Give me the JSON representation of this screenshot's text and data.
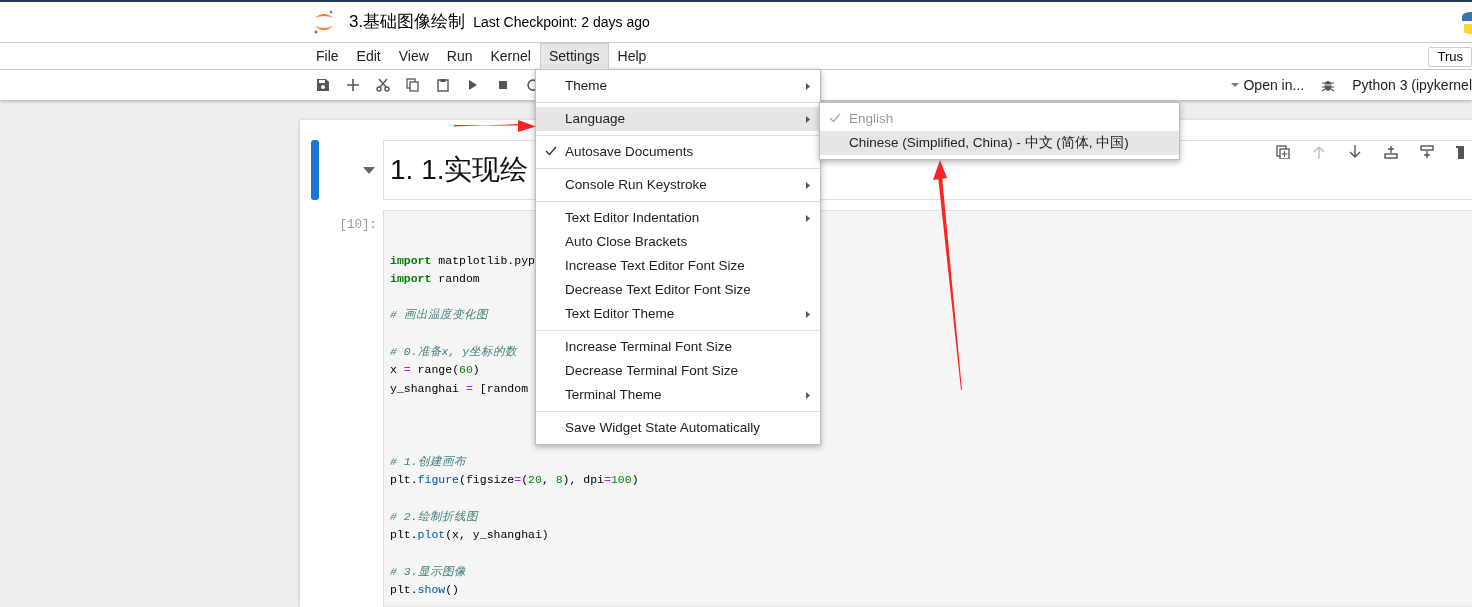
{
  "header": {
    "title": "3.基础图像绘制",
    "checkpoint": "Last Checkpoint: 2 days ago"
  },
  "menubar": [
    {
      "label": "File",
      "selected": false
    },
    {
      "label": "Edit",
      "selected": false
    },
    {
      "label": "View",
      "selected": false
    },
    {
      "label": "Run",
      "selected": false
    },
    {
      "label": "Kernel",
      "selected": false
    },
    {
      "label": "Settings",
      "selected": true
    },
    {
      "label": "Help",
      "selected": false
    }
  ],
  "trust_button": "Trus",
  "toolbar": {
    "open_in": "Open in...",
    "kernel": "Python 3 (ipykernel"
  },
  "cells": [
    {
      "kind": "markdown",
      "active": true,
      "heading": "1. 1.实现绘"
    },
    {
      "kind": "code",
      "active": false,
      "prompt": "[10]:",
      "lines": [
        {
          "kind": "blank"
        },
        {
          "kind": "blank"
        },
        {
          "kind": "code",
          "tokens": [
            {
              "kind": "kw",
              "text": "import"
            },
            {
              "kind": "plain",
              "text": " matplotlib.pyp"
            }
          ]
        },
        {
          "kind": "code",
          "tokens": [
            {
              "kind": "kw",
              "text": "import"
            },
            {
              "kind": "plain",
              "text": " random"
            }
          ]
        },
        {
          "kind": "blank"
        },
        {
          "kind": "code",
          "tokens": [
            {
              "kind": "comment",
              "text": "# 画出温度变化图"
            }
          ]
        },
        {
          "kind": "blank"
        },
        {
          "kind": "code",
          "tokens": [
            {
              "kind": "comment",
              "text": "# 0.准备x, y坐标的数"
            }
          ]
        },
        {
          "kind": "code",
          "tokens": [
            {
              "kind": "plain",
              "text": "x "
            },
            {
              "kind": "op",
              "text": "="
            },
            {
              "kind": "plain",
              "text": " range("
            },
            {
              "kind": "num",
              "text": "60"
            },
            {
              "kind": "plain",
              "text": ")"
            }
          ]
        },
        {
          "kind": "code",
          "tokens": [
            {
              "kind": "plain",
              "text": "y_shanghai "
            },
            {
              "kind": "op",
              "text": "="
            },
            {
              "kind": "plain",
              "text": " [random"
            }
          ]
        },
        {
          "kind": "blank"
        },
        {
          "kind": "blank"
        },
        {
          "kind": "blank"
        },
        {
          "kind": "code",
          "tokens": [
            {
              "kind": "comment",
              "text": "# 1.创建画布"
            }
          ]
        },
        {
          "kind": "code",
          "tokens": [
            {
              "kind": "plain",
              "text": "plt."
            },
            {
              "kind": "prop",
              "text": "figure"
            },
            {
              "kind": "plain",
              "text": "(figsize"
            },
            {
              "kind": "op",
              "text": "="
            },
            {
              "kind": "plain",
              "text": "("
            },
            {
              "kind": "num",
              "text": "20"
            },
            {
              "kind": "plain",
              "text": ", "
            },
            {
              "kind": "num",
              "text": "8"
            },
            {
              "kind": "plain",
              "text": "), dpi"
            },
            {
              "kind": "op",
              "text": "="
            },
            {
              "kind": "num",
              "text": "100"
            },
            {
              "kind": "plain",
              "text": ")"
            }
          ]
        },
        {
          "kind": "blank"
        },
        {
          "kind": "code",
          "tokens": [
            {
              "kind": "comment",
              "text": "# 2.绘制折线图"
            }
          ]
        },
        {
          "kind": "code",
          "tokens": [
            {
              "kind": "plain",
              "text": "plt."
            },
            {
              "kind": "prop",
              "text": "plot"
            },
            {
              "kind": "plain",
              "text": "(x, y_shanghai)"
            }
          ]
        },
        {
          "kind": "blank"
        },
        {
          "kind": "code",
          "tokens": [
            {
              "kind": "comment",
              "text": "# 3.显示图像"
            }
          ]
        },
        {
          "kind": "code",
          "tokens": [
            {
              "kind": "plain",
              "text": "plt."
            },
            {
              "kind": "prop",
              "text": "show"
            },
            {
              "kind": "plain",
              "text": "()"
            }
          ]
        }
      ]
    }
  ],
  "settings_menu": {
    "items": [
      {
        "kind": "item",
        "label": "Theme",
        "submenu": true,
        "checked": false,
        "highlighted": false
      },
      {
        "kind": "separator"
      },
      {
        "kind": "item",
        "label": "Language",
        "submenu": true,
        "checked": false,
        "highlighted": true
      },
      {
        "kind": "separator"
      },
      {
        "kind": "item",
        "label": "Autosave Documents",
        "submenu": false,
        "checked": true,
        "highlighted": false
      },
      {
        "kind": "separator"
      },
      {
        "kind": "item",
        "label": "Console Run Keystroke",
        "submenu": true,
        "checked": false,
        "highlighted": false
      },
      {
        "kind": "separator"
      },
      {
        "kind": "item",
        "label": "Text Editor Indentation",
        "submenu": true,
        "checked": false,
        "highlighted": false
      },
      {
        "kind": "item",
        "label": "Auto Close Brackets",
        "submenu": false,
        "checked": false,
        "highlighted": false
      },
      {
        "kind": "item",
        "label": "Increase Text Editor Font Size",
        "submenu": false,
        "checked": false,
        "highlighted": false
      },
      {
        "kind": "item",
        "label": "Decrease Text Editor Font Size",
        "submenu": false,
        "checked": false,
        "highlighted": false
      },
      {
        "kind": "item",
        "label": "Text Editor Theme",
        "submenu": true,
        "checked": false,
        "highlighted": false
      },
      {
        "kind": "separator"
      },
      {
        "kind": "item",
        "label": "Increase Terminal Font Size",
        "submenu": false,
        "checked": false,
        "highlighted": false
      },
      {
        "kind": "item",
        "label": "Decrease Terminal Font Size",
        "submenu": false,
        "checked": false,
        "highlighted": false
      },
      {
        "kind": "item",
        "label": "Terminal Theme",
        "submenu": true,
        "checked": false,
        "highlighted": false
      },
      {
        "kind": "separator"
      },
      {
        "kind": "item",
        "label": "Save Widget State Automatically",
        "submenu": false,
        "checked": false,
        "highlighted": false
      }
    ]
  },
  "language_submenu": {
    "items": [
      {
        "label": "English",
        "checked": true,
        "disabled": true,
        "highlighted": false
      },
      {
        "label": "Chinese (Simplified, China) - 中文 (简体, 中国)",
        "checked": false,
        "disabled": false,
        "highlighted": true
      }
    ]
  }
}
